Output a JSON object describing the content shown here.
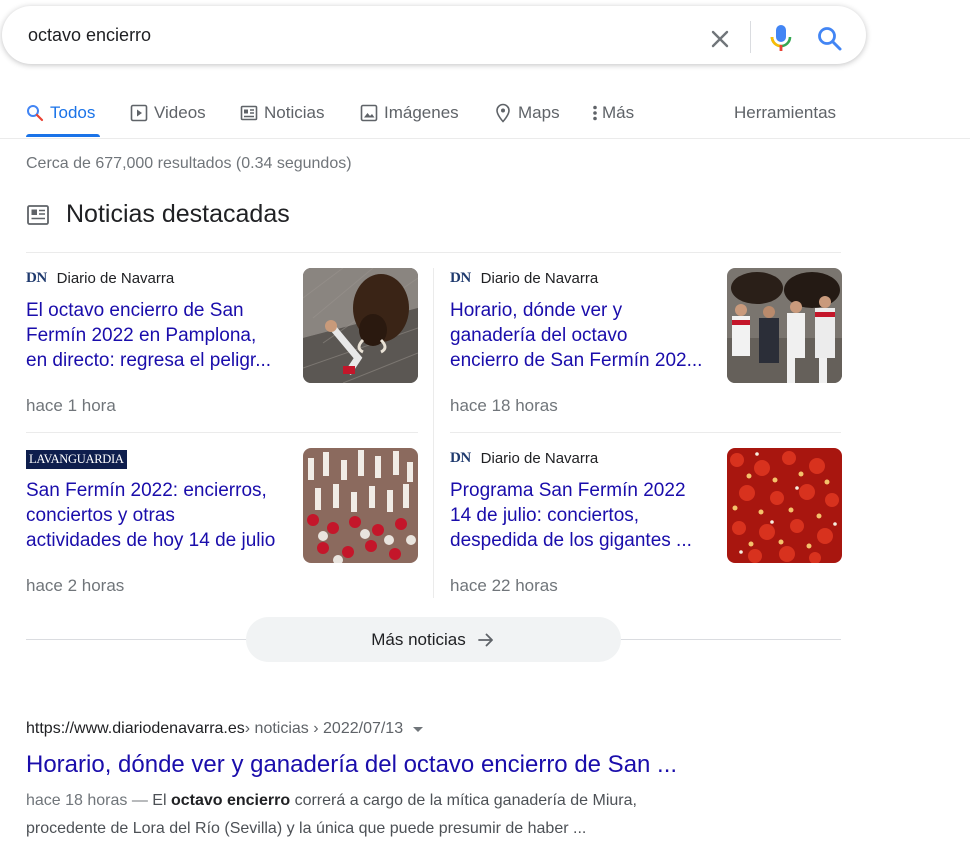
{
  "search": {
    "query": "octavo encierro"
  },
  "tabs": [
    {
      "label": "Todos",
      "icon": "search-icon",
      "active": true
    },
    {
      "label": "Videos",
      "icon": "play-icon"
    },
    {
      "label": "Noticias",
      "icon": "news-icon"
    },
    {
      "label": "Imágenes",
      "icon": "image-icon"
    },
    {
      "label": "Maps",
      "icon": "map-pin-icon"
    },
    {
      "label": "Más",
      "icon": "more-vert-icon"
    }
  ],
  "tools_label": "Herramientas",
  "result_stats": "Cerca de 677,000 resultados (0.34 segundos)",
  "top_stories": {
    "title": "Noticias destacadas",
    "cards": [
      {
        "source_logo": "DN",
        "source": "Diario de Navarra",
        "title_lines": [
          "El octavo encierro de San",
          "Fermín 2022 en Pamplona,",
          "en directo: regresa el peligr..."
        ],
        "time": "hace 1 hora"
      },
      {
        "source_logo": "DN",
        "source": "Diario de Navarra",
        "title_lines": [
          "Horario, dónde ver y",
          "ganadería del octavo",
          "encierro de San Fermín 202..."
        ],
        "time": "hace 18 horas"
      },
      {
        "source_logo": "LAVANGUARDIA",
        "source": "",
        "title_lines": [
          "San Fermín 2022: encierros,",
          "conciertos y otras",
          "actividades de hoy 14 de julio"
        ],
        "time": "hace 2 horas"
      },
      {
        "source_logo": "DN",
        "source": "Diario de Navarra",
        "title_lines": [
          "Programa San Fermín 2022",
          "14 de julio: conciertos,",
          "despedida de los gigantes ..."
        ],
        "time": "hace 22 horas"
      }
    ],
    "more_label": "Más noticias"
  },
  "result": {
    "url_domain": "https://www.diariodenavarra.es",
    "url_path": " › noticias › 2022/07/13",
    "title": "Horario, dónde ver y ganadería del octavo encierro de San ...",
    "date": "hace 18 horas — ",
    "snippet_pre": "El ",
    "snippet_bold": "octavo encierro",
    "snippet_post": " correrá a cargo de la mítica ganadería de Miura,",
    "snippet_line2": "procedente de Lora del Río (Sevilla) y la única que puede presumir de haber ..."
  },
  "colors": {
    "link": "#1a0dab",
    "accent": "#1a73e8",
    "muted": "#70757a"
  }
}
